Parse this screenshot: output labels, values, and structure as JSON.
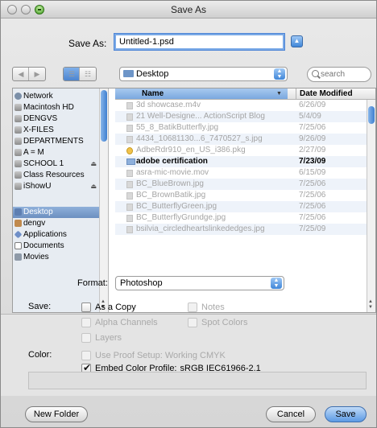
{
  "window": {
    "title": "Save As"
  },
  "save_as": {
    "label": "Save As:",
    "value": "Untitled-1.psd"
  },
  "toolbar": {
    "location": "Desktop",
    "search_placeholder": "search",
    "back_icon": "chevron-left-icon",
    "forward_icon": "chevron-right-icon",
    "list_view_icon": "list-view-icon",
    "column_view_icon": "column-view-icon"
  },
  "sidebar": {
    "devices": [
      {
        "label": "Network",
        "icon": "network-icon"
      },
      {
        "label": "Macintosh HD",
        "icon": "disk-icon"
      },
      {
        "label": "DENGVS",
        "icon": "disk-icon"
      },
      {
        "label": "X-FILES",
        "icon": "disk-icon"
      },
      {
        "label": "DEPARTMENTS",
        "icon": "disk-icon"
      },
      {
        "label": "A = M",
        "icon": "disk-icon"
      },
      {
        "label": "SCHOOL 1",
        "icon": "disk-icon",
        "eject": true
      },
      {
        "label": "Class Resources",
        "icon": "disk-icon"
      },
      {
        "label": "iShowU",
        "icon": "disk-icon",
        "eject": true
      }
    ],
    "places": [
      {
        "label": "Desktop",
        "icon": "desktop-icon",
        "selected": true
      },
      {
        "label": "dengv",
        "icon": "home-icon"
      },
      {
        "label": "Applications",
        "icon": "applications-icon"
      },
      {
        "label": "Documents",
        "icon": "documents-icon"
      },
      {
        "label": "Movies",
        "icon": "movies-icon"
      }
    ]
  },
  "files": {
    "columns": {
      "name": "Name",
      "date": "Date Modified"
    },
    "rows": [
      {
        "name": "3d showcase.m4v",
        "date": "6/26/09",
        "enabled": false,
        "icon": "file-icon"
      },
      {
        "name": "21 Well-Designe... ActionScript Blog",
        "date": "5/4/09",
        "enabled": false,
        "icon": "file-icon"
      },
      {
        "name": "55_8_BatikButterfly.jpg",
        "date": "7/25/06",
        "enabled": false,
        "icon": "file-icon"
      },
      {
        "name": "4434_10681130...6_7470527_s.jpg",
        "date": "9/26/09",
        "enabled": false,
        "icon": "file-icon"
      },
      {
        "name": "AdbeRdr910_en_US_i386.pkg",
        "date": "2/27/09",
        "enabled": false,
        "icon": "package-icon"
      },
      {
        "name": "adobe certification",
        "date": "7/23/09",
        "enabled": true,
        "icon": "folder-icon"
      },
      {
        "name": "asra-mic-movie.mov",
        "date": "6/15/09",
        "enabled": false,
        "icon": "file-icon"
      },
      {
        "name": "BC_BlueBrown.jpg",
        "date": "7/25/06",
        "enabled": false,
        "icon": "file-icon"
      },
      {
        "name": "BC_BrownBatik.jpg",
        "date": "7/25/06",
        "enabled": false,
        "icon": "file-icon"
      },
      {
        "name": "BC_ButterflyGreen.jpg",
        "date": "7/25/06",
        "enabled": false,
        "icon": "file-icon"
      },
      {
        "name": "BC_ButterflyGrundge.jpg",
        "date": "7/25/06",
        "enabled": false,
        "icon": "file-icon"
      },
      {
        "name": "bsilvia_circledheartslinkededges.jpg",
        "date": "7/25/09",
        "enabled": false,
        "icon": "file-icon"
      }
    ]
  },
  "format": {
    "label": "Format:",
    "value": "Photoshop"
  },
  "save_options": {
    "label": "Save:",
    "as_a_copy": "As a Copy",
    "notes": "Notes",
    "alpha_channels": "Alpha Channels",
    "spot_colors": "Spot Colors",
    "layers": "Layers"
  },
  "color_options": {
    "label": "Color:",
    "use_proof_setup": "Use Proof Setup:",
    "proof_value": "Working CMYK",
    "embed_profile": "Embed Color Profile:",
    "profile_value": "sRGB IEC61966-2.1"
  },
  "footer": {
    "new_folder": "New Folder",
    "cancel": "Cancel",
    "save": "Save"
  }
}
